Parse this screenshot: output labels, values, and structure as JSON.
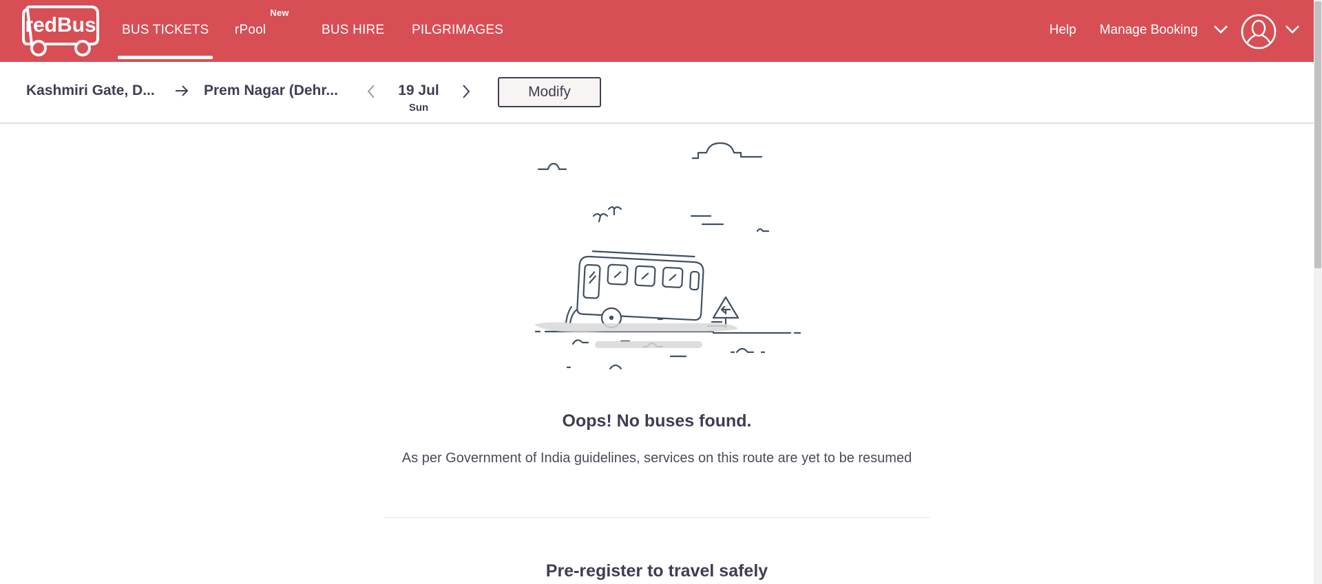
{
  "header": {
    "logo_text": "redBus",
    "nav": [
      {
        "label": "BUS TICKETS",
        "active": true
      },
      {
        "label": "rPool",
        "badge": "New"
      },
      {
        "label": "BUS HIRE"
      },
      {
        "label": "PILGRIMAGES"
      }
    ],
    "help_label": "Help",
    "manage_booking_label": "Manage Booking",
    "icons": [
      "redbus-logo-icon",
      "chevron-down-icon",
      "user-avatar-icon"
    ]
  },
  "search": {
    "from_city": "Kashmiri Gate, D...",
    "to_city": "Prem Nagar (Dehr...",
    "date": "19 Jul",
    "day": "Sun",
    "modify_label": "Modify",
    "icons": [
      "arrow-right-icon",
      "chevron-left-icon",
      "chevron-right-icon"
    ]
  },
  "result": {
    "title": "Oops! No buses found.",
    "message": "As per Government of India guidelines, services on this route are yet to be resumed",
    "pre_register_title": "Pre-register to travel safely"
  },
  "colors": {
    "brand": "#d84e55",
    "text": "#3e3e52",
    "illustration_stroke": "#3f5063",
    "illustration_shadow": "#d8d8d8"
  }
}
